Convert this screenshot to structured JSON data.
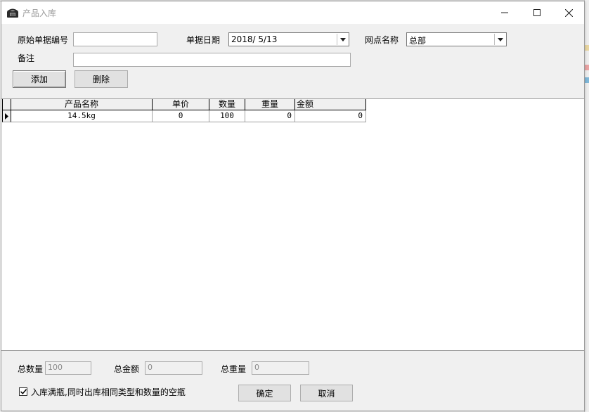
{
  "window": {
    "title": "产品入库",
    "icon": "phone-icon"
  },
  "form": {
    "original_no_label": "原始单据编号",
    "original_no_value": "",
    "date_label": "单据日期",
    "date_value": "2018/ 5/13",
    "branch_label": "网点名称",
    "branch_value": "总部",
    "remark_label": "备注",
    "remark_value": "",
    "add_label": "添加",
    "delete_label": "删除"
  },
  "grid": {
    "columns": [
      "产品名称",
      "单价",
      "数量",
      "重量",
      "金额"
    ],
    "rows": [
      [
        "14.5kg",
        "0",
        "100",
        "0",
        "0"
      ]
    ]
  },
  "totals": {
    "qty_label": "总数量",
    "qty_value": "100",
    "amount_label": "总金额",
    "amount_value": "0",
    "weight_label": "总重量",
    "weight_value": "0"
  },
  "options": {
    "checkbox_label": "入库满瓶,同时出库相同类型和数量的空瓶",
    "checkbox_checked": true
  },
  "actions": {
    "ok_label": "确定",
    "cancel_label": "取消"
  },
  "colors": {
    "window_bg": "#f0f0f0",
    "grid_bg": "#ffffff"
  }
}
